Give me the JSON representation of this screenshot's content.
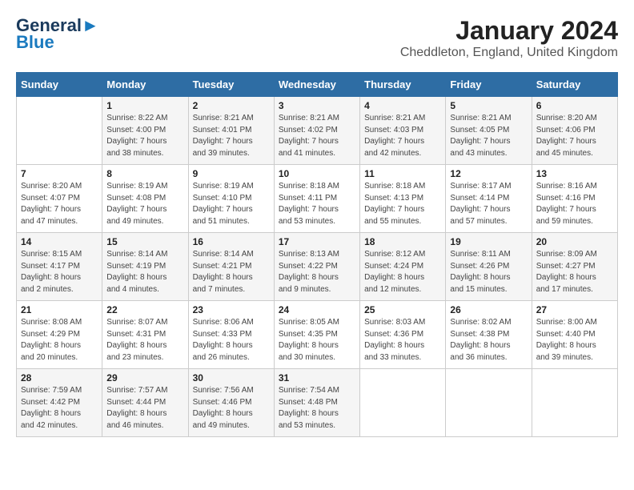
{
  "header": {
    "logo_line1": "General",
    "logo_line2": "Blue",
    "month": "January 2024",
    "location": "Cheddleton, England, United Kingdom"
  },
  "weekdays": [
    "Sunday",
    "Monday",
    "Tuesday",
    "Wednesday",
    "Thursday",
    "Friday",
    "Saturday"
  ],
  "weeks": [
    [
      {
        "day": "",
        "info": ""
      },
      {
        "day": "1",
        "info": "Sunrise: 8:22 AM\nSunset: 4:00 PM\nDaylight: 7 hours\nand 38 minutes."
      },
      {
        "day": "2",
        "info": "Sunrise: 8:21 AM\nSunset: 4:01 PM\nDaylight: 7 hours\nand 39 minutes."
      },
      {
        "day": "3",
        "info": "Sunrise: 8:21 AM\nSunset: 4:02 PM\nDaylight: 7 hours\nand 41 minutes."
      },
      {
        "day": "4",
        "info": "Sunrise: 8:21 AM\nSunset: 4:03 PM\nDaylight: 7 hours\nand 42 minutes."
      },
      {
        "day": "5",
        "info": "Sunrise: 8:21 AM\nSunset: 4:05 PM\nDaylight: 7 hours\nand 43 minutes."
      },
      {
        "day": "6",
        "info": "Sunrise: 8:20 AM\nSunset: 4:06 PM\nDaylight: 7 hours\nand 45 minutes."
      }
    ],
    [
      {
        "day": "7",
        "info": "Sunrise: 8:20 AM\nSunset: 4:07 PM\nDaylight: 7 hours\nand 47 minutes."
      },
      {
        "day": "8",
        "info": "Sunrise: 8:19 AM\nSunset: 4:08 PM\nDaylight: 7 hours\nand 49 minutes."
      },
      {
        "day": "9",
        "info": "Sunrise: 8:19 AM\nSunset: 4:10 PM\nDaylight: 7 hours\nand 51 minutes."
      },
      {
        "day": "10",
        "info": "Sunrise: 8:18 AM\nSunset: 4:11 PM\nDaylight: 7 hours\nand 53 minutes."
      },
      {
        "day": "11",
        "info": "Sunrise: 8:18 AM\nSunset: 4:13 PM\nDaylight: 7 hours\nand 55 minutes."
      },
      {
        "day": "12",
        "info": "Sunrise: 8:17 AM\nSunset: 4:14 PM\nDaylight: 7 hours\nand 57 minutes."
      },
      {
        "day": "13",
        "info": "Sunrise: 8:16 AM\nSunset: 4:16 PM\nDaylight: 7 hours\nand 59 minutes."
      }
    ],
    [
      {
        "day": "14",
        "info": "Sunrise: 8:15 AM\nSunset: 4:17 PM\nDaylight: 8 hours\nand 2 minutes."
      },
      {
        "day": "15",
        "info": "Sunrise: 8:14 AM\nSunset: 4:19 PM\nDaylight: 8 hours\nand 4 minutes."
      },
      {
        "day": "16",
        "info": "Sunrise: 8:14 AM\nSunset: 4:21 PM\nDaylight: 8 hours\nand 7 minutes."
      },
      {
        "day": "17",
        "info": "Sunrise: 8:13 AM\nSunset: 4:22 PM\nDaylight: 8 hours\nand 9 minutes."
      },
      {
        "day": "18",
        "info": "Sunrise: 8:12 AM\nSunset: 4:24 PM\nDaylight: 8 hours\nand 12 minutes."
      },
      {
        "day": "19",
        "info": "Sunrise: 8:11 AM\nSunset: 4:26 PM\nDaylight: 8 hours\nand 15 minutes."
      },
      {
        "day": "20",
        "info": "Sunrise: 8:09 AM\nSunset: 4:27 PM\nDaylight: 8 hours\nand 17 minutes."
      }
    ],
    [
      {
        "day": "21",
        "info": "Sunrise: 8:08 AM\nSunset: 4:29 PM\nDaylight: 8 hours\nand 20 minutes."
      },
      {
        "day": "22",
        "info": "Sunrise: 8:07 AM\nSunset: 4:31 PM\nDaylight: 8 hours\nand 23 minutes."
      },
      {
        "day": "23",
        "info": "Sunrise: 8:06 AM\nSunset: 4:33 PM\nDaylight: 8 hours\nand 26 minutes."
      },
      {
        "day": "24",
        "info": "Sunrise: 8:05 AM\nSunset: 4:35 PM\nDaylight: 8 hours\nand 30 minutes."
      },
      {
        "day": "25",
        "info": "Sunrise: 8:03 AM\nSunset: 4:36 PM\nDaylight: 8 hours\nand 33 minutes."
      },
      {
        "day": "26",
        "info": "Sunrise: 8:02 AM\nSunset: 4:38 PM\nDaylight: 8 hours\nand 36 minutes."
      },
      {
        "day": "27",
        "info": "Sunrise: 8:00 AM\nSunset: 4:40 PM\nDaylight: 8 hours\nand 39 minutes."
      }
    ],
    [
      {
        "day": "28",
        "info": "Sunrise: 7:59 AM\nSunset: 4:42 PM\nDaylight: 8 hours\nand 42 minutes."
      },
      {
        "day": "29",
        "info": "Sunrise: 7:57 AM\nSunset: 4:44 PM\nDaylight: 8 hours\nand 46 minutes."
      },
      {
        "day": "30",
        "info": "Sunrise: 7:56 AM\nSunset: 4:46 PM\nDaylight: 8 hours\nand 49 minutes."
      },
      {
        "day": "31",
        "info": "Sunrise: 7:54 AM\nSunset: 4:48 PM\nDaylight: 8 hours\nand 53 minutes."
      },
      {
        "day": "",
        "info": ""
      },
      {
        "day": "",
        "info": ""
      },
      {
        "day": "",
        "info": ""
      }
    ]
  ]
}
